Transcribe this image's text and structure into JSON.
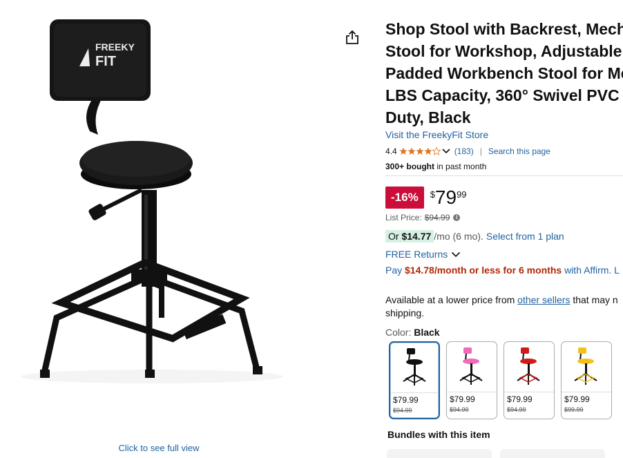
{
  "image": {
    "see_full_view": "Click to see full view",
    "logo_text_top": "FREEKY",
    "logo_text_bottom": "FIT"
  },
  "product": {
    "title_lines": [
      "Shop Stool with Backrest, Mech",
      "Stool for Workshop, Adjustable",
      "Padded Workbench Stool for Me",
      "LBS Capacity, 360° Swivel PVC S",
      "Duty, Black"
    ],
    "store_link": "Visit the FreekyFit Store",
    "rating": "4.4",
    "rating_value": 4.4,
    "review_count": "(183)",
    "search_this_page": "Search this page",
    "bought_bold": "300+ bought",
    "bought_rest": " in past month"
  },
  "pricing": {
    "discount": "-16%",
    "currency_symbol": "$",
    "price_whole": "79",
    "price_fraction": "99",
    "list_price_label": "List Price:",
    "list_price": "$94.99",
    "monthly_prefix": "Or ",
    "monthly_amount": "$14.77",
    "monthly_suffix": "/mo (6 mo).",
    "select_plan": "Select from 1 plan",
    "free_returns": "FREE Returns",
    "affirm_prefix": "Pay ",
    "affirm_amount": "$14.78/month or less for 6 months",
    "affirm_suffix": " with Affirm. L"
  },
  "availability": {
    "line1_prefix": "Available at a lower price from ",
    "line1_link": "other sellers",
    "line1_suffix": " that may n",
    "line2": "shipping."
  },
  "color_options": {
    "label": "Color: ",
    "selected": "Black",
    "swatches": [
      {
        "name": "Black",
        "price": "$79.99",
        "old_price": "$94.99",
        "color": "#111111",
        "selected": true
      },
      {
        "name": "Pink",
        "price": "$79.99",
        "old_price": "$94.99",
        "color": "#f06ab8",
        "selected": false
      },
      {
        "name": "Red",
        "price": "$79.99",
        "old_price": "$94.99",
        "color": "#d11a1a",
        "selected": false
      },
      {
        "name": "Yellow",
        "price": "$79.99",
        "old_price": "$99.99",
        "color": "#f2c21b",
        "selected": false
      }
    ]
  },
  "bundles": {
    "heading": "Bundles with this item"
  },
  "colors": {
    "link": "#2162a1",
    "deal_red": "#cc0c39",
    "price_red": "#b12704",
    "star": "#de7921"
  }
}
